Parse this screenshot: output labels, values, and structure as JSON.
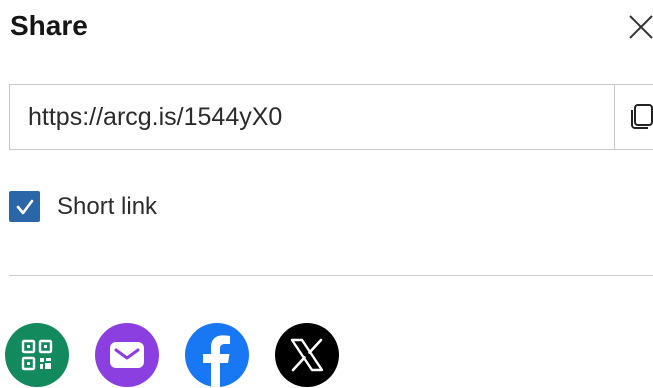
{
  "dialog": {
    "title": "Share"
  },
  "link": {
    "value": "https://arcg.is/1544yX0"
  },
  "short_link": {
    "label": "Short link",
    "checked": true
  },
  "share_targets": [
    {
      "icon": "qr-code-icon",
      "color": "#138a5e"
    },
    {
      "icon": "email-icon",
      "color": "#8c3fe0"
    },
    {
      "icon": "facebook-icon",
      "color": "#1877f2"
    },
    {
      "icon": "x-icon",
      "color": "#000000"
    }
  ],
  "colors": {
    "checkbox": "#2a66a8",
    "border": "#c9c9c9"
  }
}
